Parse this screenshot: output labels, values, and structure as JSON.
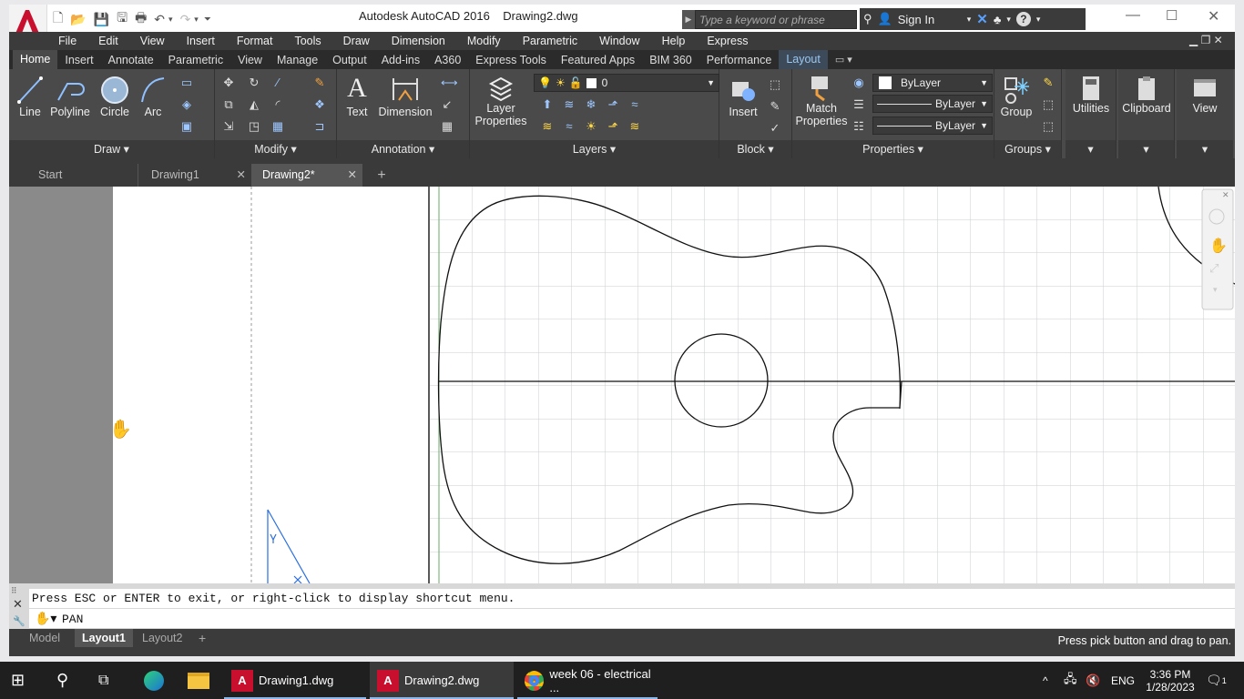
{
  "window": {
    "app_name": "Autodesk AutoCAD 2016",
    "file_name": "Drawing2.dwg",
    "search_placeholder": "Type a keyword or phrase",
    "sign_in": "Sign In"
  },
  "menu": [
    "File",
    "Edit",
    "View",
    "Insert",
    "Format",
    "Tools",
    "Draw",
    "Dimension",
    "Modify",
    "Parametric",
    "Window",
    "Help",
    "Express"
  ],
  "ribbon_tabs": [
    "Home",
    "Insert",
    "Annotate",
    "Parametric",
    "View",
    "Manage",
    "Output",
    "Add-ins",
    "A360",
    "Express Tools",
    "Featured Apps",
    "BIM 360",
    "Performance",
    "Layout"
  ],
  "ribbon": {
    "draw": {
      "title": "Draw",
      "line": "Line",
      "polyline": "Polyline",
      "circle": "Circle",
      "arc": "Arc"
    },
    "modify": {
      "title": "Modify"
    },
    "annotation": {
      "title": "Annotation",
      "text": "Text",
      "dimension": "Dimension"
    },
    "layers": {
      "title": "Layers",
      "layer_properties_1": "Layer",
      "layer_properties_2": "Properties",
      "current_layer": "0"
    },
    "block": {
      "title": "Block",
      "insert": "Insert"
    },
    "properties": {
      "title": "Properties",
      "match_1": "Match",
      "match_2": "Properties",
      "color": "ByLayer",
      "linetype": "ByLayer",
      "lineweight": "ByLayer"
    },
    "groups": {
      "title": "Groups",
      "group": "Group"
    },
    "utilities": "Utilities",
    "clipboard": "Clipboard",
    "view": "View"
  },
  "doc_tabs": {
    "start": "Start",
    "drawing1": "Drawing1",
    "drawing2": "Drawing2*"
  },
  "command": {
    "history": "Press ESC or ENTER to exit, or right-click to display shortcut menu.",
    "current": "PAN"
  },
  "layout_tabs": {
    "model": "Model",
    "layout1": "Layout1",
    "layout2": "Layout2"
  },
  "status_message": "Press pick button and drag to pan.",
  "taskbar": {
    "items": [
      "Drawing1.dwg",
      "Drawing2.dwg",
      "week 06 - electrical ..."
    ],
    "language": "ENG",
    "time": "3:36 PM",
    "date": "1/28/2023",
    "notifications": "1"
  },
  "colors": {
    "ribbon_bg": "#4a4a4a",
    "menu_bg": "#3b3b3b",
    "viewport_grid": "#c8ccd2",
    "ucs_blue": "#2a6fe0",
    "autocad_red": "#c8102e"
  }
}
